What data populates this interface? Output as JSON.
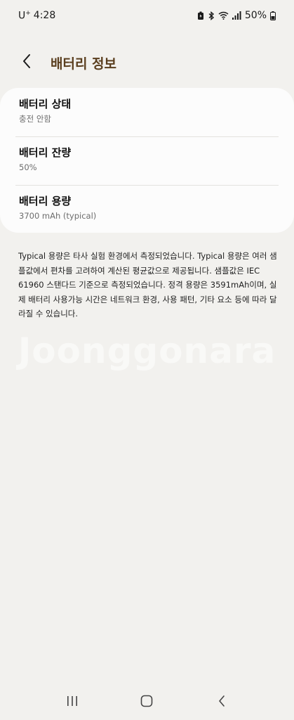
{
  "status_bar": {
    "carrier": "U",
    "carrier_sup": "+",
    "time": "4:28",
    "battery_percent": "50%"
  },
  "header": {
    "title": "배터리 정보"
  },
  "items": [
    {
      "title": "배터리 상태",
      "value": "충전 안함"
    },
    {
      "title": "배터리 잔량",
      "value": "50%"
    },
    {
      "title": "배터리 용량",
      "value": "3700 mAh (typical)"
    }
  ],
  "info": {
    "text": "Typical 용량은 타사 실험 환경에서 측정되었습니다. Typical 용량은 여러 샘플값에서 편차를 고려하여 계산된 평균값으로 제공됩니다. 샘플값은 IEC 61960 스탠다드 기준으로 측정되었습니다. 정격 용량은 3591mAh이며, 실제 배터리 사용가능 시간은 네트워크 환경, 사용 패턴, 기타 요소 등에 따라 달라질 수 있습니다."
  },
  "watermark": "Joonggonara",
  "icons": {
    "back": "chevron-left-icon",
    "recents": "recents-icon",
    "home": "home-icon",
    "nav_back": "nav-back-icon"
  },
  "colors": {
    "background": "#f2f1ee",
    "card": "#fcfcfc",
    "title_accent": "#5a3e1e"
  }
}
